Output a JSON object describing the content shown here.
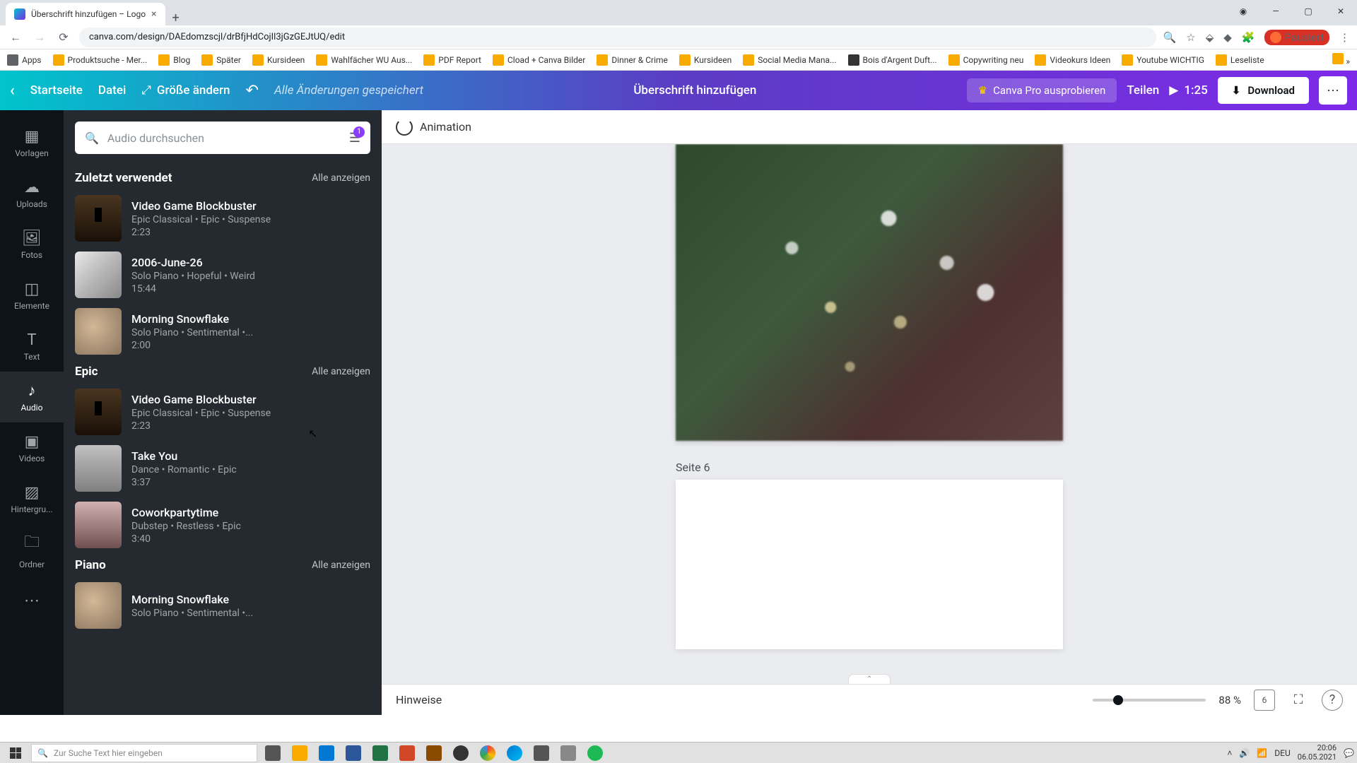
{
  "browser": {
    "tab_title": "Überschrift hinzufügen – Logo",
    "url": "canva.com/design/DAEdomzscjl/drBfjHdCojIl3jGzGEJtUQ/edit",
    "ext_label": "Pausiert",
    "bookmarks": [
      "Apps",
      "Produktsuche - Mer...",
      "Blog",
      "Später",
      "Kursideen",
      "Wahlfächer WU Aus...",
      "PDF Report",
      "Cload + Canva Bilder",
      "Dinner & Crime",
      "Kursideen",
      "Social Media Mana...",
      "Bois d'Argent Duft...",
      "Copywriting neu",
      "Videokurs Ideen",
      "Youtube WICHTIG",
      "Leseliste"
    ]
  },
  "toolbar": {
    "home": "Startseite",
    "file": "Datei",
    "resize": "Größe ändern",
    "status": "Alle Änderungen gespeichert",
    "title": "Überschrift hinzufügen",
    "pro": "Canva Pro ausprobieren",
    "share": "Teilen",
    "duration": "1:25",
    "download": "Download"
  },
  "rail": {
    "templates": "Vorlagen",
    "uploads": "Uploads",
    "photos": "Fotos",
    "elements": "Elemente",
    "text": "Text",
    "audio": "Audio",
    "videos": "Videos",
    "background": "Hintergru...",
    "folders": "Ordner"
  },
  "panel": {
    "search_placeholder": "Audio durchsuchen",
    "filter_count": "1",
    "show_all": "Alle anzeigen",
    "sections": [
      {
        "title": "Zuletzt verwendet",
        "tracks": [
          {
            "title": "Video Game Blockbuster",
            "meta": "Epic Classical • Epic • Suspense",
            "dur": "2:23",
            "thumb": "t1"
          },
          {
            "title": "2006-June-26",
            "meta": "Solo Piano • Hopeful • Weird",
            "dur": "15:44",
            "thumb": "t2"
          },
          {
            "title": "Morning Snowflake",
            "meta": "Solo Piano • Sentimental •...",
            "dur": "2:00",
            "thumb": "t3"
          }
        ]
      },
      {
        "title": "Epic",
        "tracks": [
          {
            "title": "Video Game Blockbuster",
            "meta": "Epic Classical • Epic • Suspense",
            "dur": "2:23",
            "thumb": "t1"
          },
          {
            "title": "Take You",
            "meta": "Dance • Romantic • Epic",
            "dur": "3:37",
            "thumb": "t4"
          },
          {
            "title": "Coworkpartytime",
            "meta": "Dubstep • Restless • Epic",
            "dur": "3:40",
            "thumb": "t5"
          }
        ]
      },
      {
        "title": "Piano",
        "tracks": [
          {
            "title": "Morning Snowflake",
            "meta": "Solo Piano • Sentimental •...",
            "dur": "",
            "thumb": "t3"
          }
        ]
      }
    ]
  },
  "context": {
    "animation": "Animation"
  },
  "canvas": {
    "page_label": "Seite 6"
  },
  "bottom": {
    "notes": "Hinweise",
    "zoom": "88 %",
    "grid_num": "6"
  },
  "taskbar": {
    "search_placeholder": "Zur Suche Text hier eingeben",
    "lang": "DEU",
    "time": "20:06",
    "date": "06.05.2021"
  }
}
